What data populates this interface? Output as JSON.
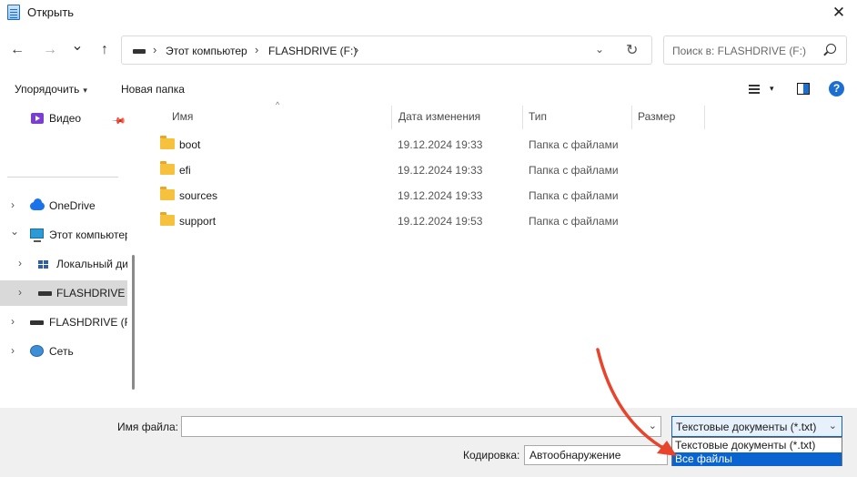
{
  "window": {
    "title": "Открыть",
    "close_glyph": "✕"
  },
  "nav": {
    "back_glyph": "←",
    "forward_glyph": "→",
    "recent_glyph": "⌄",
    "up_glyph": "↑",
    "breadcrumbs": [
      "Этот компьютер",
      "FLASHDRIVE (F:)"
    ],
    "separator_glyph": "›",
    "refresh_glyph": "↻",
    "dropdown_glyph": "⌄"
  },
  "search": {
    "placeholder": "Поиск в: FLASHDRIVE (F:)"
  },
  "toolbar": {
    "organize_label": "Упорядочить",
    "new_folder_label": "Новая папка",
    "caret": "▾",
    "help_glyph": "?"
  },
  "sidebar": {
    "quick_access": [
      {
        "label": "Видео",
        "icon": "video-icon",
        "pinned": true
      }
    ],
    "tree": [
      {
        "label": "OneDrive",
        "icon": "cloud-icon",
        "chevron": "›",
        "level": 0
      },
      {
        "label": "Этот компьютер",
        "icon": "computer-icon",
        "chevron": "⌄",
        "level": 0
      },
      {
        "label": "Локальный диск (C:)",
        "icon": "disk-icon",
        "chevron": "›",
        "level": 1
      },
      {
        "label": "FLASHDRIVE (F:)",
        "icon": "drive-icon",
        "chevron": "›",
        "level": 1,
        "selected": true
      },
      {
        "label": "FLASHDRIVE (F:)",
        "icon": "drive-icon",
        "chevron": "›",
        "level": 0
      },
      {
        "label": "Сеть",
        "icon": "network-icon",
        "chevron": "›",
        "level": 0
      }
    ]
  },
  "columns": {
    "name": "Имя",
    "date": "Дата изменения",
    "type": "Тип",
    "size": "Размер",
    "sort_glyph": "^"
  },
  "files": [
    {
      "name": "boot",
      "date": "19.12.2024 19:33",
      "type": "Папка с файлами"
    },
    {
      "name": "efi",
      "date": "19.12.2024 19:33",
      "type": "Папка с файлами"
    },
    {
      "name": "sources",
      "date": "19.12.2024 19:33",
      "type": "Папка с файлами"
    },
    {
      "name": "support",
      "date": "19.12.2024 19:53",
      "type": "Папка с файлами"
    }
  ],
  "bottom": {
    "filename_label": "Имя файла:",
    "filename_value": "",
    "filetype_selected": "Текстовые документы (*.txt)",
    "filetype_options": [
      "Текстовые документы (*.txt)",
      "Все файлы"
    ],
    "filetype_highlighted": "Все файлы",
    "encoding_label": "Кодировка:",
    "encoding_value": "Автообнаружение",
    "chevron": "⌄"
  },
  "colors": {
    "accent": "#0a64d0",
    "annotation_arrow": "#e8442c",
    "folder": "#f6c13c"
  }
}
